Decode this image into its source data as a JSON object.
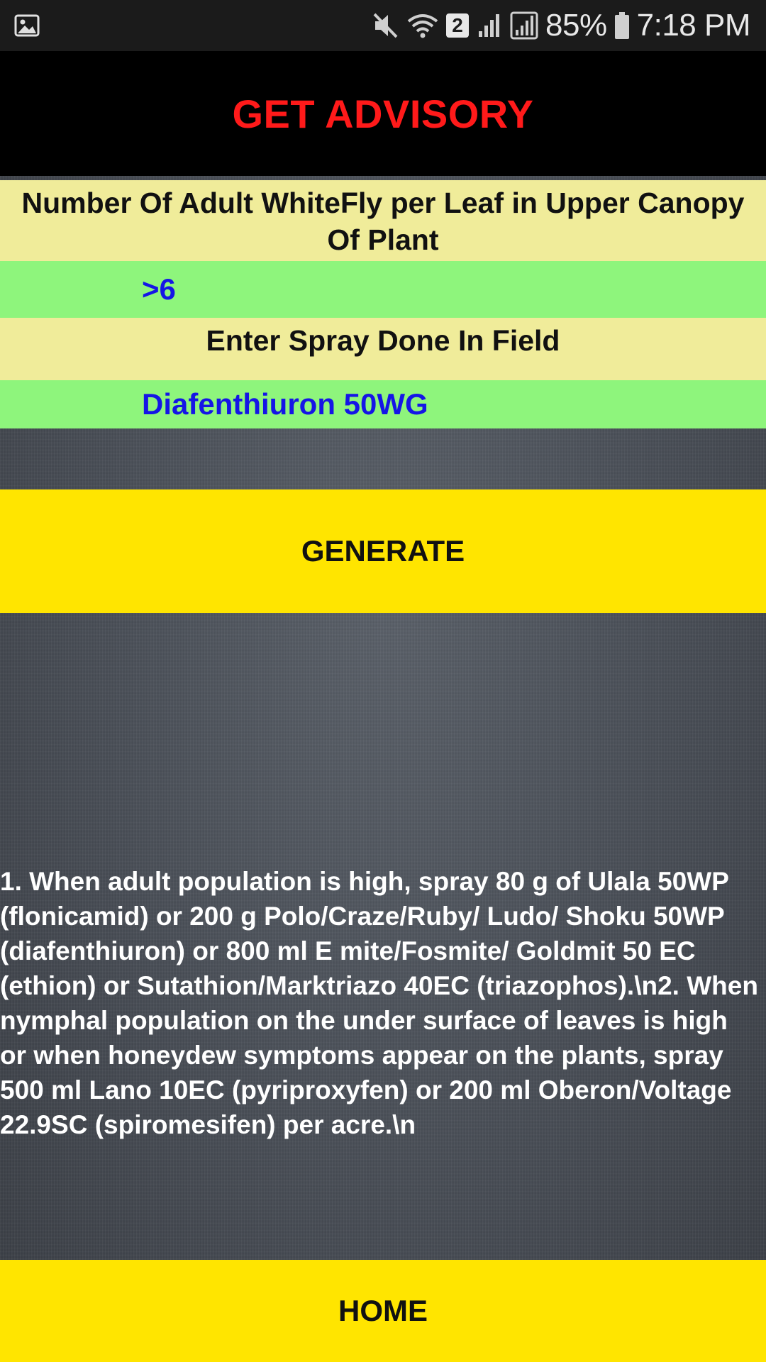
{
  "status_bar": {
    "battery": "85%",
    "time": "7:18 PM",
    "notification_count": "2",
    "icons": [
      "gallery-icon",
      "mute-icon",
      "wifi-icon",
      "signal-roaming-icon",
      "signal-icon",
      "battery-icon"
    ]
  },
  "header": {
    "title": "GET ADVISORY",
    "title_color": "#ff1a1a"
  },
  "form": {
    "question_label": "Number Of Adult WhiteFly per Leaf in Upper Canopy Of Plant",
    "question_value": ">6",
    "spray_label": "Enter Spray Done In Field",
    "spray_value": "Diafenthiuron 50WG"
  },
  "actions": {
    "generate_label": "GENERATE",
    "home_label": "HOME"
  },
  "result": {
    "advisory_text": "1. When adult population is high, spray 80 g of Ulala 50WP (flonicamid) or 200 g Polo/Craze/Ruby/ Ludo/ Shoku 50WP (diafenthiuron) or 800 ml E mite/Fosmite/ Goldmit 50 EC (ethion) or Sutathion/Marktriazo 40EC (triazophos).\\n2. When nymphal population on the under surface of leaves is high or when honeydew symptoms appear on the plants, spray 500 ml Lano 10EC (pyriproxyfen) or 200 ml Oberon/Voltage 22.9SC (spiromesifen) per acre.\\n"
  },
  "colors": {
    "label_bg": "#f0ec9a",
    "value_bg": "#8ef57c",
    "value_text": "#1515e6",
    "button_bg": "#ffe500"
  }
}
